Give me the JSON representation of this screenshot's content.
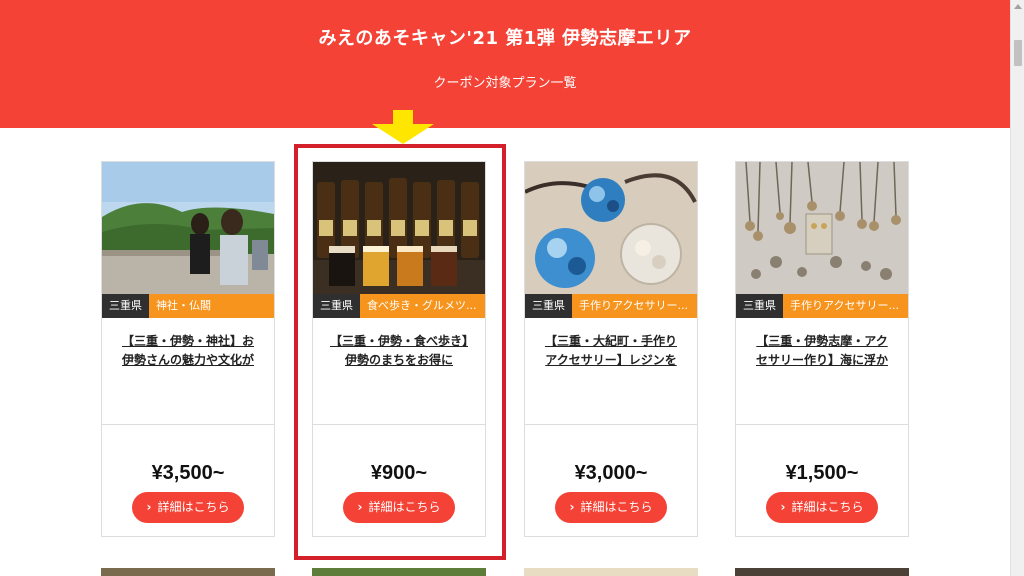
{
  "header": {
    "title": "みえのあそキャン'21 第1弾 伊勢志摩エリア",
    "subtitle": "クーポン対象プラン一覧",
    "bg_color": "#f44336"
  },
  "cards": [
    {
      "pref": "三重県",
      "category": "神社・仏閣",
      "title": "【三重・伊勢・神社】お伊勢さんの魅力や文化が",
      "price": "¥3,500~",
      "button": "詳細はこちら"
    },
    {
      "pref": "三重県",
      "category": "食べ歩き・グルメツ...",
      "title": "【三重・伊勢・食べ歩き】伊勢のまちをお得に",
      "price": "¥900~",
      "button": "詳細はこちら"
    },
    {
      "pref": "三重県",
      "category": "手作りアクセサリー...",
      "title": "【三重・大紀町・手作りアクセサリー】レジンを",
      "price": "¥3,000~",
      "button": "詳細はこちら"
    },
    {
      "pref": "三重県",
      "category": "手作りアクセサリー...",
      "title": "【三重・伊勢志摩・アクセサリー作り】海に浮か",
      "price": "¥1,500~",
      "button": "詳細はこちら"
    }
  ],
  "colors": {
    "accent": "#f44336",
    "highlight": "#d3202a",
    "arrow": "#ffe600",
    "tag_category": "#f7941d",
    "tag_pref": "#2f2f2f"
  }
}
